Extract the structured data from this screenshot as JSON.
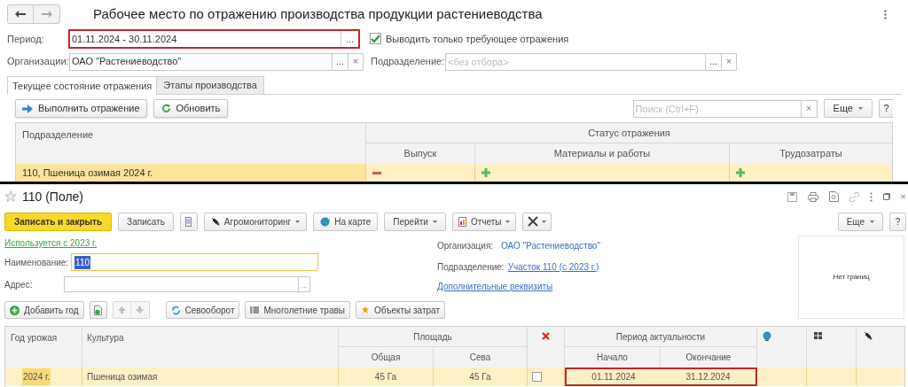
{
  "workplace": {
    "title": "Рабочее место по отражению производства продукции растениеводства",
    "period": {
      "label": "Период:",
      "value": "01.11.2024 - 30.11.2024",
      "select": "...",
      "highlighted": true
    },
    "only_required": {
      "label": "Выводить только требующее отражения",
      "checked": true
    },
    "organization": {
      "label": "Организации:",
      "value": "ОАО \"Растениеводство\"",
      "select": "...",
      "clear": "×"
    },
    "division": {
      "label": "Подразделение:",
      "placeholder": "<без отбора>",
      "select": "...",
      "clear": "×"
    },
    "tabs": [
      {
        "label": "Текущее состояние отражения",
        "selected": true
      },
      {
        "label": "Этапы производства",
        "selected": false
      }
    ],
    "buttons": {
      "reflect": "Выполнить отражение",
      "refresh": "Обновить",
      "more": "Еще",
      "help": "?"
    },
    "search": {
      "placeholder": "Поиск (Ctrl+F)",
      "clear": "×"
    },
    "table": {
      "columns": {
        "division": "Подразделение",
        "status": "Статус отражения",
        "output": "Выпуск",
        "materials": "Материалы и работы",
        "labor": "Трудозатраты"
      },
      "rows": [
        {
          "division": "110, Пшеница озимая 2024 г.",
          "selected": true,
          "output_reflected": false,
          "materials_reflected": true,
          "labor_reflected": true
        }
      ]
    }
  },
  "field_form": {
    "title": "110 (Поле)",
    "toolbar": {
      "save_close": "Записать и закрыть",
      "save": "Записать",
      "agro": "Агромониторинг",
      "map": "На карте",
      "goto": "Перейти",
      "reports": "Отчеты",
      "more": "Еще",
      "help": "?"
    },
    "used_since": "Используется с 2023 г.",
    "name": {
      "label": "Наименование:",
      "value": "110"
    },
    "address": {
      "label": "Адрес:",
      "select": "..."
    },
    "organization": {
      "label": "Организация:",
      "value": "ОАО \"Растениеводство\""
    },
    "division": {
      "label": "Подразделение:",
      "value": "Участок 110 (с 2023 г.)"
    },
    "extra_link": "Дополнительные реквизиты",
    "map_preview": "Нет границ",
    "buttons": {
      "add_year": "Добавить год",
      "rotation": "Севооборот",
      "grasses": "Многолетние травы",
      "cost_objects": "Объекты затрат"
    },
    "table": {
      "columns": {
        "year": "Год урожая",
        "crop": "Культура",
        "area": "Площадь",
        "total": "Общая",
        "sown": "Сева",
        "period": "Период актуальности",
        "start": "Начало",
        "end": "Окончание"
      },
      "rows": [
        {
          "year": "2024 г.",
          "crop": "Пшеница озимая",
          "total": "45 Га",
          "sown": "45 Га",
          "excluded": false,
          "start": "01.11.2024",
          "end": "31.12.2024",
          "selected": true,
          "period_highlighted": true
        }
      ]
    }
  }
}
